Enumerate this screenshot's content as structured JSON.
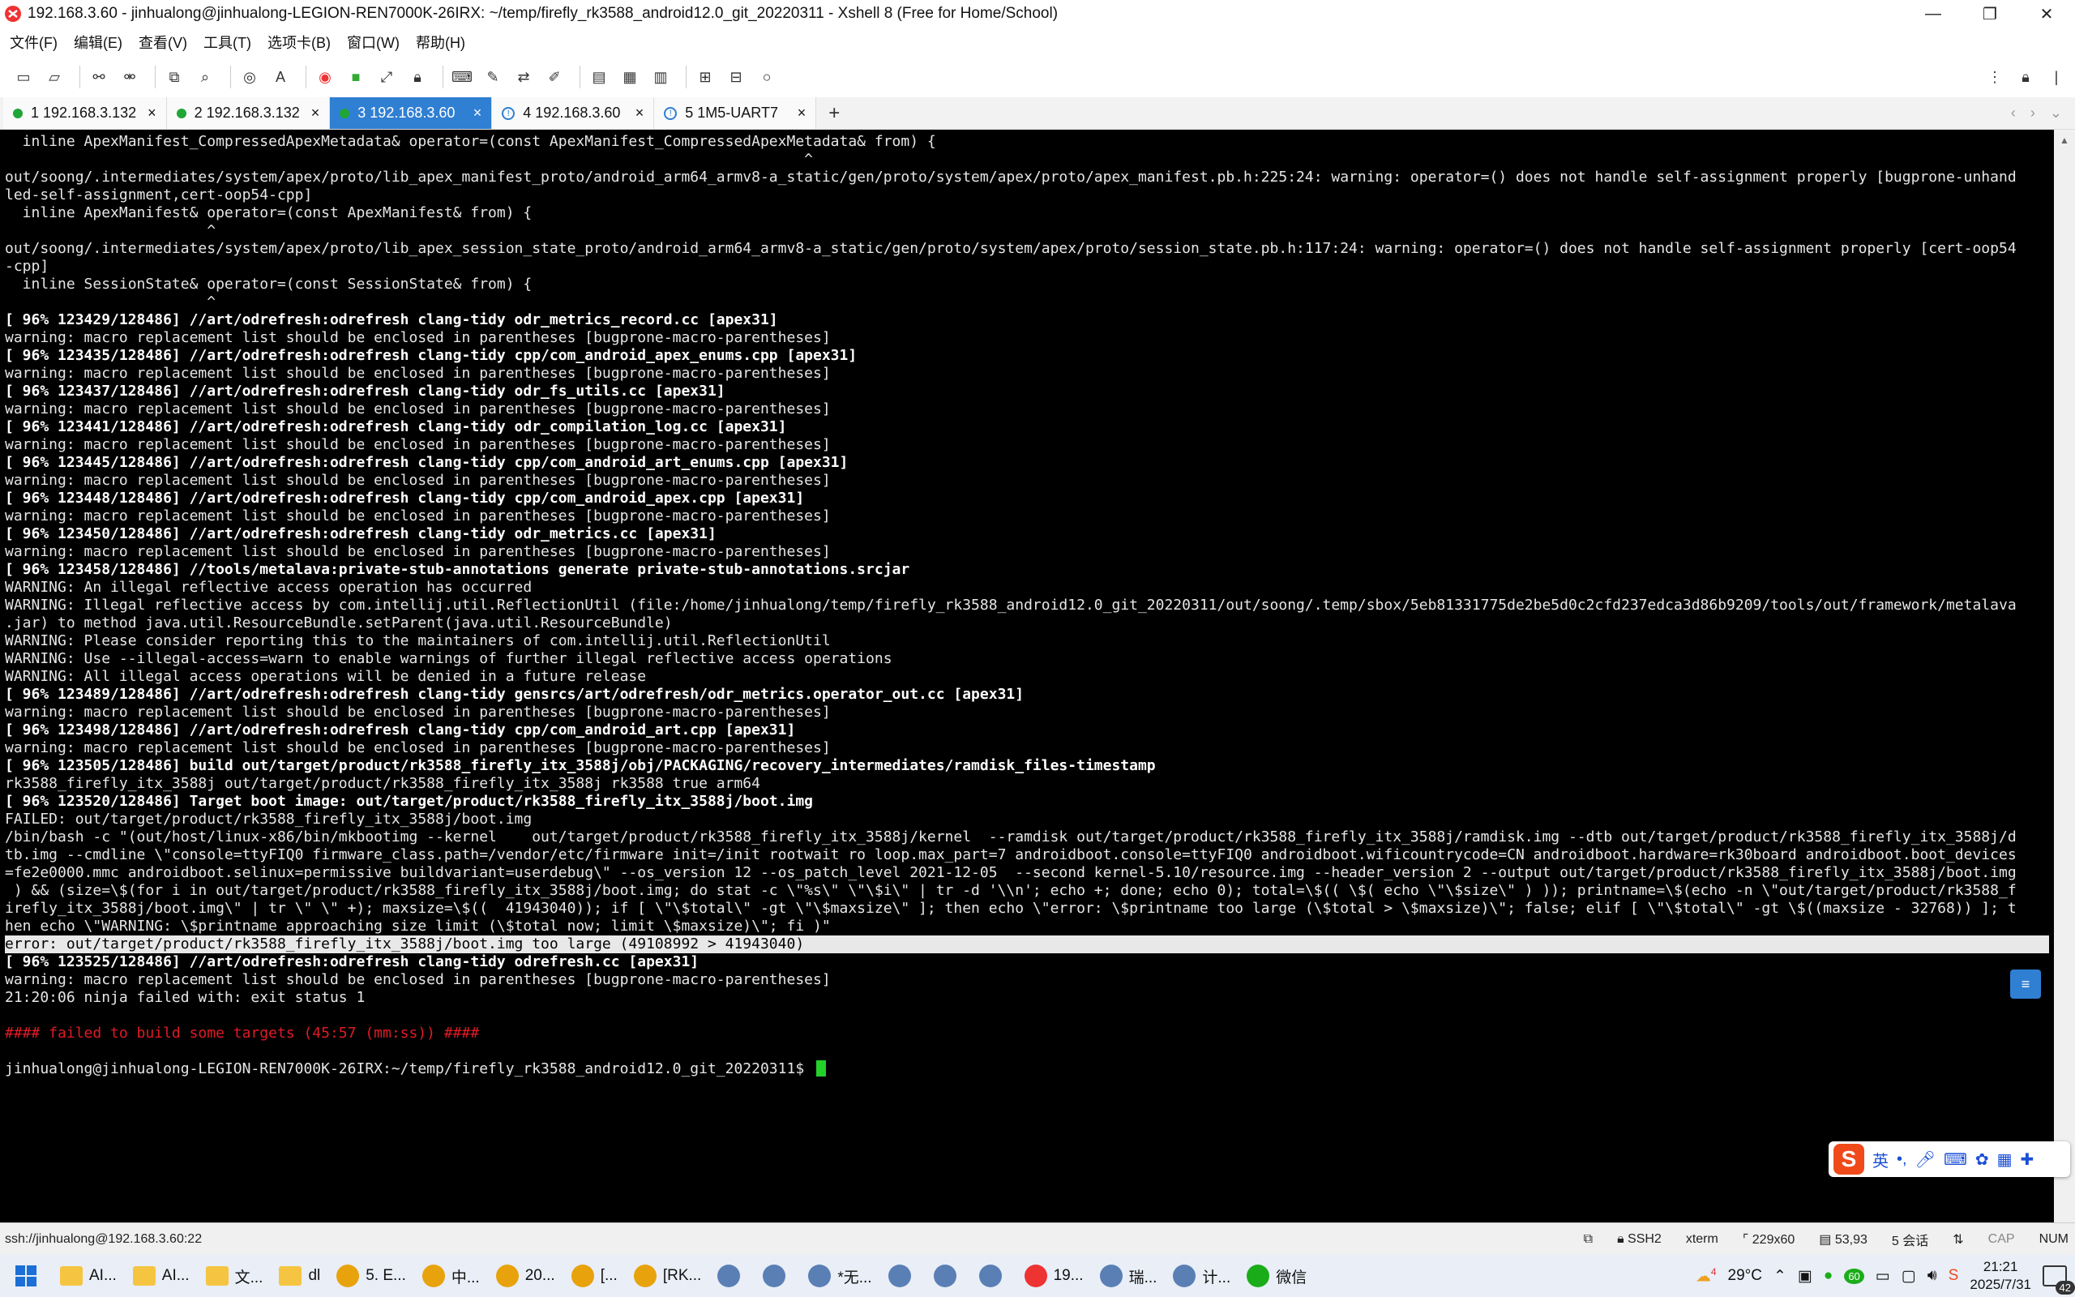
{
  "window": {
    "title": "192.168.3.60 - jinhualong@jinhualong-LEGION-REN7000K-26IRX: ~/temp/firefly_rk3588_android12.0_git_20220311 - Xshell 8 (Free for Home/School)",
    "minimize": "—",
    "maximize": "❐",
    "close": "✕"
  },
  "menu": [
    "文件(F)",
    "编辑(E)",
    "查看(V)",
    "工具(T)",
    "选项卡(B)",
    "窗口(W)",
    "帮助(H)"
  ],
  "tabs": [
    {
      "label": "1 192.168.3.132",
      "status": "connected",
      "color": "#1fa637"
    },
    {
      "label": "2 192.168.3.132",
      "status": "connected",
      "color": "#1fa637"
    },
    {
      "label": "3 192.168.3.60",
      "status": "active",
      "color": "#1fa637"
    },
    {
      "label": "4 192.168.3.60",
      "status": "info",
      "color": "#2f7fd3"
    },
    {
      "label": "5 1M5-UART7",
      "status": "info",
      "color": "#2f7fd3"
    }
  ],
  "tab_add": "+",
  "terminal": {
    "lines": [
      {
        "t": "  inline ApexManifest_CompressedApexMetadata& operator=(const ApexManifest_CompressedApexMetadata& from) {",
        "s": ""
      },
      {
        "t": "                                                                                           ^",
        "s": ""
      },
      {
        "t": "out/soong/.intermediates/system/apex/proto/lib_apex_manifest_proto/android_arm64_armv8-a_static/gen/proto/system/apex/proto/apex_manifest.pb.h:225:24: warning: operator=() does not handle self-assignment properly [bugprone-unhand",
        "s": ""
      },
      {
        "t": "led-self-assignment,cert-oop54-cpp]",
        "s": ""
      },
      {
        "t": "  inline ApexManifest& operator=(const ApexManifest& from) {",
        "s": ""
      },
      {
        "t": "                       ^",
        "s": ""
      },
      {
        "t": "out/soong/.intermediates/system/apex/proto/lib_apex_session_state_proto/android_arm64_armv8-a_static/gen/proto/system/apex/proto/session_state.pb.h:117:24: warning: operator=() does not handle self-assignment properly [cert-oop54",
        "s": ""
      },
      {
        "t": "-cpp]",
        "s": ""
      },
      {
        "t": "  inline SessionState& operator=(const SessionState& from) {",
        "s": ""
      },
      {
        "t": "                       ^",
        "s": ""
      },
      {
        "t": "[ 96% 123429/128486] //art/odrefresh:odrefresh clang-tidy odr_metrics_record.cc [apex31]",
        "s": "bold"
      },
      {
        "t": "warning: macro replacement list should be enclosed in parentheses [bugprone-macro-parentheses]",
        "s": ""
      },
      {
        "t": "[ 96% 123435/128486] //art/odrefresh:odrefresh clang-tidy cpp/com_android_apex_enums.cpp [apex31]",
        "s": "bold"
      },
      {
        "t": "warning: macro replacement list should be enclosed in parentheses [bugprone-macro-parentheses]",
        "s": ""
      },
      {
        "t": "[ 96% 123437/128486] //art/odrefresh:odrefresh clang-tidy odr_fs_utils.cc [apex31]",
        "s": "bold"
      },
      {
        "t": "warning: macro replacement list should be enclosed in parentheses [bugprone-macro-parentheses]",
        "s": ""
      },
      {
        "t": "[ 96% 123441/128486] //art/odrefresh:odrefresh clang-tidy odr_compilation_log.cc [apex31]",
        "s": "bold"
      },
      {
        "t": "warning: macro replacement list should be enclosed in parentheses [bugprone-macro-parentheses]",
        "s": ""
      },
      {
        "t": "[ 96% 123445/128486] //art/odrefresh:odrefresh clang-tidy cpp/com_android_art_enums.cpp [apex31]",
        "s": "bold"
      },
      {
        "t": "warning: macro replacement list should be enclosed in parentheses [bugprone-macro-parentheses]",
        "s": ""
      },
      {
        "t": "[ 96% 123448/128486] //art/odrefresh:odrefresh clang-tidy cpp/com_android_apex.cpp [apex31]",
        "s": "bold"
      },
      {
        "t": "warning: macro replacement list should be enclosed in parentheses [bugprone-macro-parentheses]",
        "s": ""
      },
      {
        "t": "[ 96% 123450/128486] //art/odrefresh:odrefresh clang-tidy odr_metrics.cc [apex31]",
        "s": "bold"
      },
      {
        "t": "warning: macro replacement list should be enclosed in parentheses [bugprone-macro-parentheses]",
        "s": ""
      },
      {
        "t": "[ 96% 123458/128486] //tools/metalava:private-stub-annotations generate private-stub-annotations.srcjar",
        "s": "bold"
      },
      {
        "t": "WARNING: An illegal reflective access operation has occurred",
        "s": ""
      },
      {
        "t": "WARNING: Illegal reflective access by com.intellij.util.ReflectionUtil (file:/home/jinhualong/temp/firefly_rk3588_android12.0_git_20220311/out/soong/.temp/sbox/5eb81331775de2be5d0c2cfd237edca3d86b9209/tools/out/framework/metalava",
        "s": ""
      },
      {
        "t": ".jar) to method java.util.ResourceBundle.setParent(java.util.ResourceBundle)",
        "s": ""
      },
      {
        "t": "WARNING: Please consider reporting this to the maintainers of com.intellij.util.ReflectionUtil",
        "s": ""
      },
      {
        "t": "WARNING: Use --illegal-access=warn to enable warnings of further illegal reflective access operations",
        "s": ""
      },
      {
        "t": "WARNING: All illegal access operations will be denied in a future release",
        "s": ""
      },
      {
        "t": "[ 96% 123489/128486] //art/odrefresh:odrefresh clang-tidy gensrcs/art/odrefresh/odr_metrics.operator_out.cc [apex31]",
        "s": "bold"
      },
      {
        "t": "warning: macro replacement list should be enclosed in parentheses [bugprone-macro-parentheses]",
        "s": ""
      },
      {
        "t": "[ 96% 123498/128486] //art/odrefresh:odrefresh clang-tidy cpp/com_android_art.cpp [apex31]",
        "s": "bold"
      },
      {
        "t": "warning: macro replacement list should be enclosed in parentheses [bugprone-macro-parentheses]",
        "s": ""
      },
      {
        "t": "[ 96% 123505/128486] build out/target/product/rk3588_firefly_itx_3588j/obj/PACKAGING/recovery_intermediates/ramdisk_files-timestamp",
        "s": "bold"
      },
      {
        "t": "rk3588_firefly_itx_3588j out/target/product/rk3588_firefly_itx_3588j rk3588 true arm64",
        "s": ""
      },
      {
        "t": "[ 96% 123520/128486] Target boot image: out/target/product/rk3588_firefly_itx_3588j/boot.img",
        "s": "bold"
      },
      {
        "t": "FAILED: out/target/product/rk3588_firefly_itx_3588j/boot.img",
        "s": ""
      },
      {
        "t": "/bin/bash -c \"(out/host/linux-x86/bin/mkbootimg --kernel    out/target/product/rk3588_firefly_itx_3588j/kernel  --ramdisk out/target/product/rk3588_firefly_itx_3588j/ramdisk.img --dtb out/target/product/rk3588_firefly_itx_3588j/d",
        "s": ""
      },
      {
        "t": "tb.img --cmdline \\\"console=ttyFIQ0 firmware_class.path=/vendor/etc/firmware init=/init rootwait ro loop.max_part=7 androidboot.console=ttyFIQ0 androidboot.wificountrycode=CN androidboot.hardware=rk30board androidboot.boot_devices",
        "s": ""
      },
      {
        "t": "=fe2e0000.mmc androidboot.selinux=permissive buildvariant=userdebug\\\" --os_version 12 --os_patch_level 2021-12-05  --second kernel-5.10/resource.img --header_version 2 --output out/target/product/rk3588_firefly_itx_3588j/boot.img",
        "s": ""
      },
      {
        "t": " ) && (size=\\$(for i in out/target/product/rk3588_firefly_itx_3588j/boot.img; do stat -c \\\"%s\\\" \\\"\\$i\\\" | tr -d '\\\\n'; echo +; done; echo 0); total=\\$(( \\$( echo \\\"\\$size\\\" ) )); printname=\\$(echo -n \\\"out/target/product/rk3588_f",
        "s": ""
      },
      {
        "t": "irefly_itx_3588j/boot.img\\\" | tr \\\" \\\" +); maxsize=\\$((  41943040)); if [ \\\"\\$total\\\" -gt \\\"\\$maxsize\\\" ]; then echo \\\"error: \\$printname too large (\\$total > \\$maxsize)\\\"; false; elif [ \\\"\\$total\\\" -gt \\$((maxsize - 32768)) ]; t",
        "s": ""
      },
      {
        "t": "hen echo \\\"WARNING: \\$printname approaching size limit (\\$total now; limit \\$maxsize)\\\"; fi )\"",
        "s": ""
      },
      {
        "t": "error: out/target/product/rk3588_firefly_itx_3588j/boot.img too large (49108992 > 41943040)",
        "s": "hl"
      },
      {
        "t": "[ 96% 123525/128486] //art/odrefresh:odrefresh clang-tidy odrefresh.cc [apex31]",
        "s": "bold"
      },
      {
        "t": "warning: macro replacement list should be enclosed in parentheses [bugprone-macro-parentheses]",
        "s": ""
      },
      {
        "t": "21:20:06 ninja failed with: exit status 1",
        "s": ""
      },
      {
        "t": "",
        "s": ""
      },
      {
        "t": "#### failed to build some targets (45:57 (mm:ss)) ####",
        "s": "red"
      },
      {
        "t": "",
        "s": ""
      },
      {
        "t": "jinhualong@jinhualong-LEGION-REN7000K-26IRX:~/temp/firefly_rk3588_android12.0_git_20220311$ ",
        "s": "prompt"
      }
    ]
  },
  "ime": {
    "logo": "S",
    "mode": "英"
  },
  "statusbar": {
    "connection": "ssh://jinhualong@192.168.3.60:22",
    "protocol": "SSH2",
    "term": "xterm",
    "size": "229x60",
    "cursor": "53,93",
    "sessions": "5 会话",
    "cap": "CAP",
    "num": "NUM"
  },
  "taskbar": {
    "items": [
      {
        "label": "AI...",
        "kind": "folder"
      },
      {
        "label": "AI...",
        "kind": "folder"
      },
      {
        "label": "文...",
        "kind": "folder"
      },
      {
        "label": "dl",
        "kind": "folder"
      },
      {
        "label": "5. E...",
        "kind": "chrome"
      },
      {
        "label": "中...",
        "kind": "chrome"
      },
      {
        "label": "20...",
        "kind": "chrome"
      },
      {
        "label": "[...",
        "kind": "chrome"
      },
      {
        "label": "[RK...",
        "kind": "chrome"
      },
      {
        "label": "",
        "kind": "app"
      },
      {
        "label": "",
        "kind": "app"
      },
      {
        "label": "*无...",
        "kind": "app"
      },
      {
        "label": "",
        "kind": "app"
      },
      {
        "label": "",
        "kind": "app"
      },
      {
        "label": "",
        "kind": "app"
      },
      {
        "label": "19...",
        "kind": "xshell"
      },
      {
        "label": "瑞...",
        "kind": "app"
      },
      {
        "label": "计...",
        "kind": "app"
      },
      {
        "label": "微信",
        "kind": "wechat"
      }
    ],
    "weather": "29°C",
    "time": "21:21",
    "date": "2025/7/31",
    "notifications": "42",
    "weather_badge": "4",
    "tray_badge": "60"
  },
  "colors": {
    "accent": "#2f7fd3",
    "cursor": "#23d12a",
    "error_red": "#e01b24"
  }
}
